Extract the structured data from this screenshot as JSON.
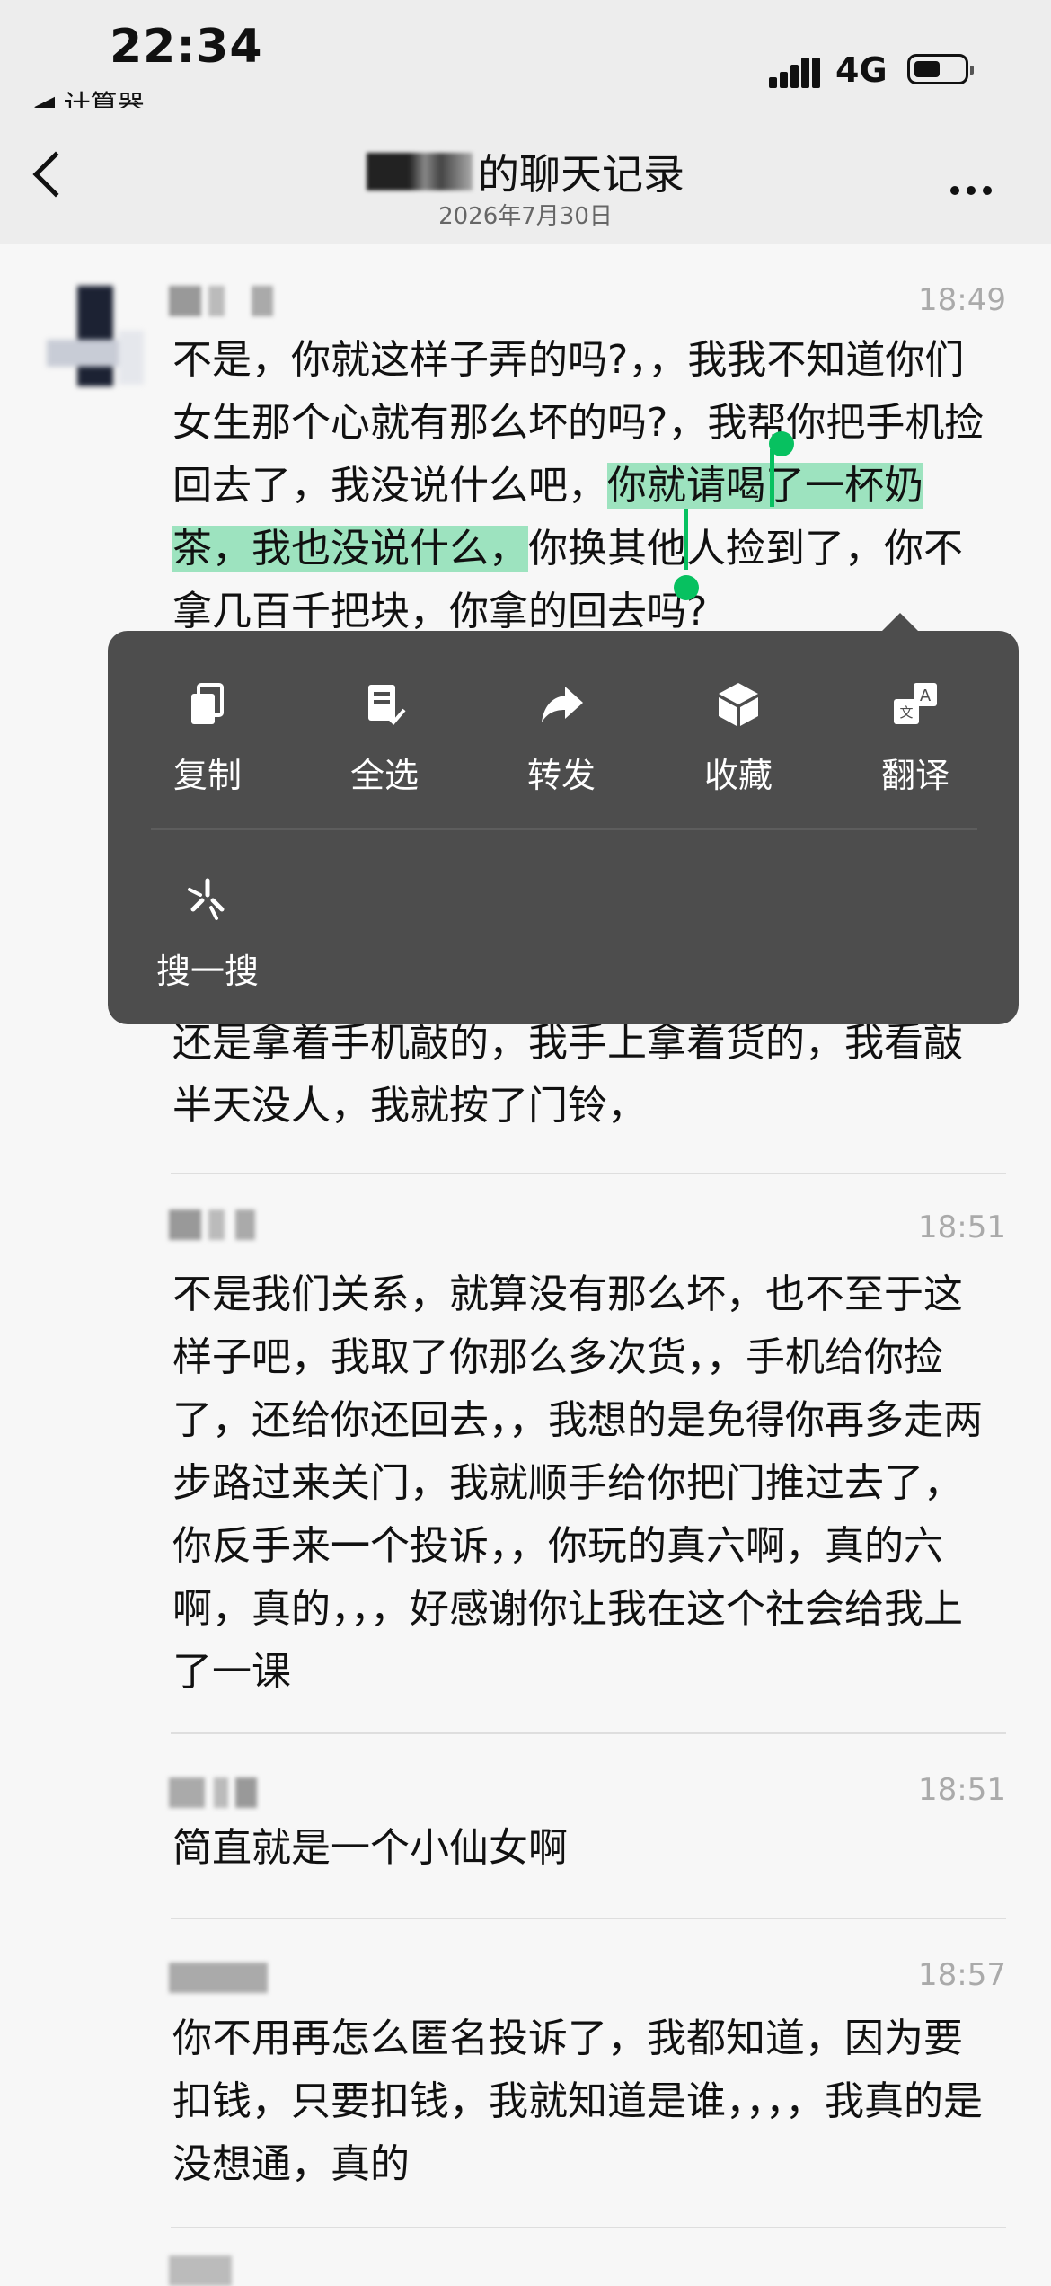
{
  "status_bar": {
    "time": "22:34",
    "back_app": "◀ 计算器",
    "network": "4G"
  },
  "nav": {
    "title": "的聊天记录",
    "subtitle": "2026年7月30日"
  },
  "messages": [
    {
      "time": "18:49",
      "before": "不是，你就这样子弄的吗?，，我我不知道你们女生那个心就有那么坏的吗?，我帮你把手机捡回去了，我没说什么吧，",
      "selected": "你就请喝了一杯奶茶，我也没说什么，",
      "after": "你换其他人捡到了，你不拿几百千把块，你拿的回去吗?"
    },
    {
      "continuation": "还是拿着手机敲的，我手上拿着货的，我看敲半天没人，我就按了门铃，"
    },
    {
      "time": "18:51",
      "text": "不是我们关系，就算没有那么坏，也不至于这样子吧，我取了你那么多次货，，手机给你捡了，还给你还回去，，我想的是免得你再多走两步路过来关门，我就顺手给你把门推过去了，你反手来一个投诉，，你玩的真六啊，真的六啊，真的，，，好感谢你让我在这个社会给我上了一课"
    },
    {
      "time": "18:51",
      "text": "简直就是一个小仙女啊"
    },
    {
      "time": "18:57",
      "text": "你不用再怎么匿名投诉了，我都知道，因为要扣钱，只要扣钱，我就知道是谁，，，，我真的是没想通，真的"
    }
  ],
  "context_menu": {
    "items": [
      {
        "label": "复制",
        "icon": "copy-icon"
      },
      {
        "label": "全选",
        "icon": "select-all-icon"
      },
      {
        "label": "转发",
        "icon": "forward-icon"
      },
      {
        "label": "收藏",
        "icon": "favorite-icon"
      },
      {
        "label": "翻译",
        "icon": "translate-icon"
      },
      {
        "label": "搜一搜",
        "icon": "search-sparkle-icon"
      }
    ]
  },
  "colors": {
    "accent": "#07c160",
    "highlight": "#9de3bf",
    "popup_bg": "#4d4d4d"
  }
}
